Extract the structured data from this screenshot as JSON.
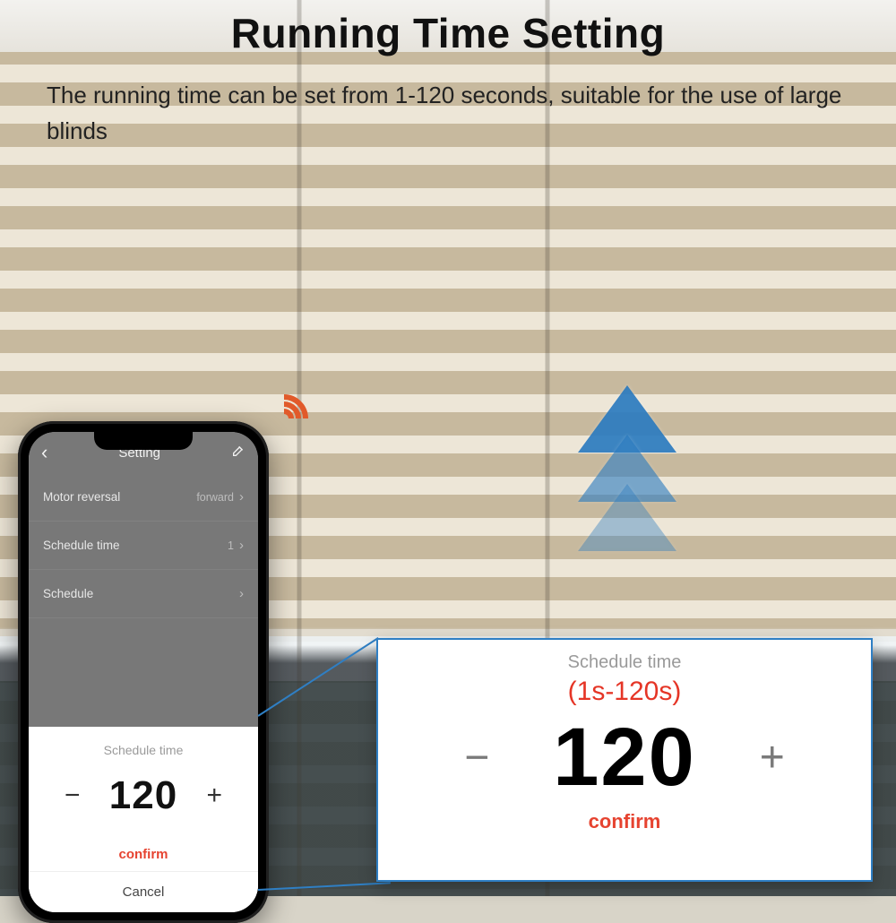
{
  "header": {
    "title": "Running Time Setting",
    "subtitle": "The running time can be set from 1-120 seconds, suitable for the use of large blinds"
  },
  "phone": {
    "app_title": "Setting",
    "rows": [
      {
        "label": "Motor reversal",
        "value": "forward"
      },
      {
        "label": "Schedule time",
        "value": "1"
      },
      {
        "label": "Schedule",
        "value": ""
      }
    ],
    "sheet": {
      "title": "Schedule time",
      "minus": "−",
      "plus": "+",
      "value": "120",
      "confirm": "confirm",
      "cancel": "Cancel"
    }
  },
  "zoom": {
    "title": "Schedule time",
    "range": "(1s-120s)",
    "minus": "−",
    "plus": "+",
    "value": "120",
    "confirm": "confirm"
  }
}
